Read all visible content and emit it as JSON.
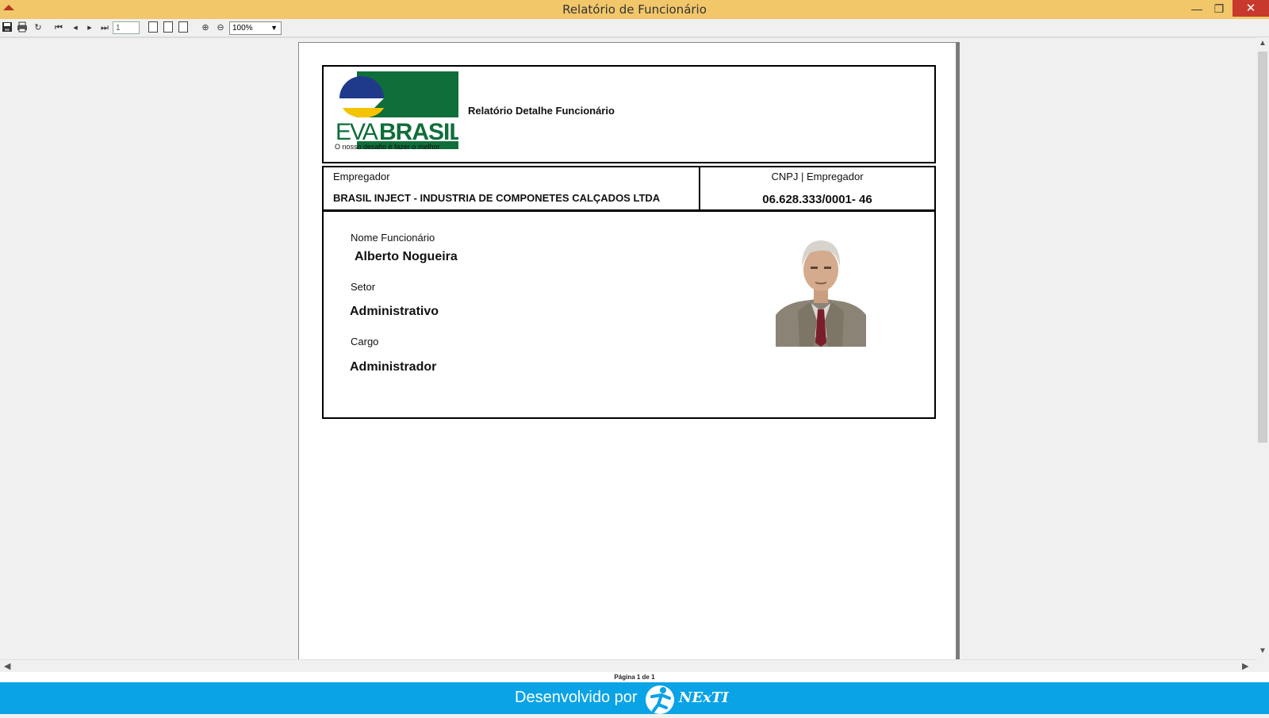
{
  "window": {
    "title": "Relatório de Funcionário",
    "minimize": "—",
    "maximize": "❐",
    "close": "✕"
  },
  "toolbar": {
    "page_number": "1",
    "zoom": "100%",
    "first_page": "⏮",
    "prev_page": "◂",
    "next_page": "▸",
    "last_page": "⏭",
    "refresh": "↻",
    "zoom_in": "⊕",
    "zoom_out": "⊖"
  },
  "report": {
    "logo_brand": "EVABRASIL",
    "logo_tagline": "O nosso desafio é fazer o melhor",
    "title": "Relatório Detalhe  Funcionário",
    "employer_label": "Empregador",
    "employer_value": "BRASIL INJECT - INDUSTRIA DE COMPONETES CALÇADOS LTDA",
    "cnpj_label": "CNPJ | Empregador",
    "cnpj_value": "06.628.333/0001- 46",
    "name_label": "Nome Funcionário",
    "name_value": "Alberto Nogueira",
    "sector_label": "Setor",
    "sector_value": "Administrativo",
    "role_label": "Cargo",
    "role_value": "Administrador"
  },
  "status": {
    "page_info": "Página 1 de 1"
  },
  "footer": {
    "developed_by": "Desenvolvido por",
    "brand": "NExTI"
  },
  "colors": {
    "titlebar": "#f2c76a",
    "footer": "#0aa3e6",
    "logo_green": "#0f6e3a",
    "logo_yellow": "#f5c400",
    "logo_blue": "#1f3a8a"
  }
}
